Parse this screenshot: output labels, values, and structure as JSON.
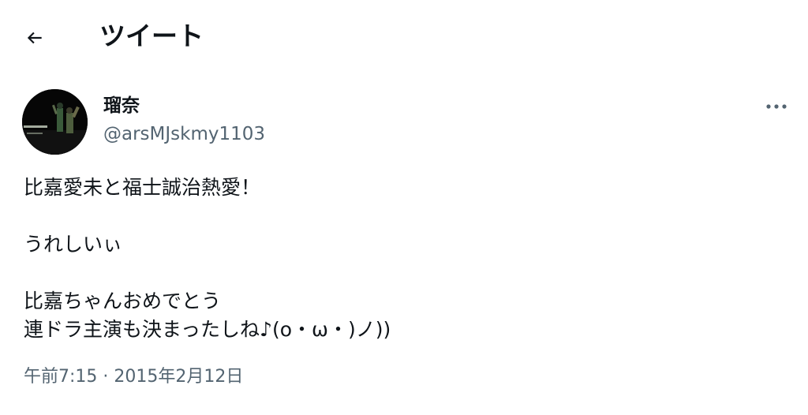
{
  "header": {
    "back_icon": "back-arrow-icon",
    "title": "ツイート"
  },
  "author": {
    "display_name": "瑠奈",
    "handle": "@arsMJskmy1103"
  },
  "more_icon": "more-options-icon",
  "tweet": {
    "lines": [
      "比嘉愛未と福士誠治熱愛！",
      "",
      "うれしいぃ",
      "",
      "比嘉ちゃんおめでとう",
      "連ドラ主演も決まったしね♪(ο・ω・)ノ))"
    ]
  },
  "meta": {
    "time": "午前7:15",
    "separator": " · ",
    "date": "2015年2月12日"
  }
}
